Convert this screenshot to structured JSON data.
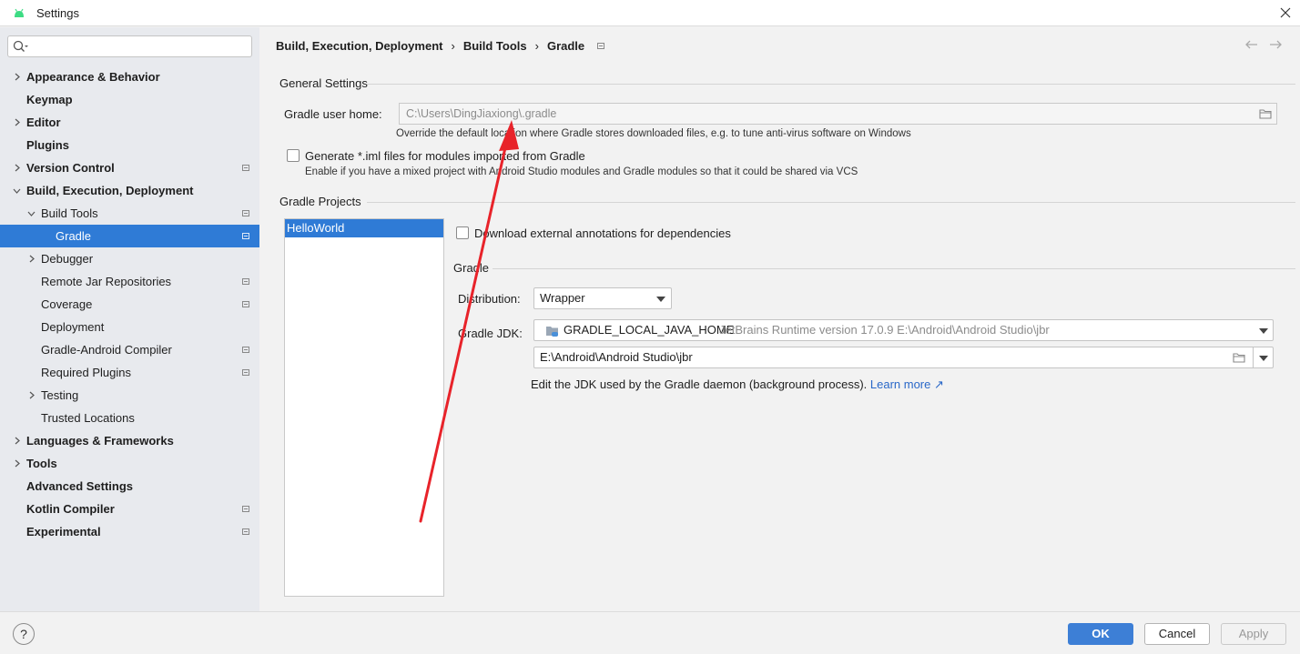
{
  "window": {
    "title": "Settings"
  },
  "search": {
    "placeholder": "",
    "value": ""
  },
  "sidebar": {
    "items": [
      {
        "label": "Appearance & Behavior"
      },
      {
        "label": "Keymap"
      },
      {
        "label": "Editor"
      },
      {
        "label": "Plugins"
      },
      {
        "label": "Version Control"
      },
      {
        "label": "Build, Execution, Deployment"
      },
      {
        "label": "Build Tools"
      },
      {
        "label": "Gradle"
      },
      {
        "label": "Debugger"
      },
      {
        "label": "Remote Jar Repositories"
      },
      {
        "label": "Coverage"
      },
      {
        "label": "Deployment"
      },
      {
        "label": "Gradle-Android Compiler"
      },
      {
        "label": "Required Plugins"
      },
      {
        "label": "Testing"
      },
      {
        "label": "Trusted Locations"
      },
      {
        "label": "Languages & Frameworks"
      },
      {
        "label": "Tools"
      },
      {
        "label": "Advanced Settings"
      },
      {
        "label": "Kotlin Compiler"
      },
      {
        "label": "Experimental"
      }
    ]
  },
  "breadcrumb": {
    "part1": "Build, Execution, Deployment",
    "sep": "›",
    "part2": "Build Tools",
    "part3": "Gradle"
  },
  "general": {
    "title": "General Settings",
    "user_home_label": "Gradle user home:",
    "user_home_value": "C:\\Users\\DingJiaxiong\\.gradle",
    "user_home_hint": "Override the default location where Gradle stores downloaded files, e.g. to tune anti-virus software on Windows",
    "iml_label": "Generate *.iml files for modules imported from Gradle",
    "iml_hint": "Enable if you have a mixed project with Android Studio modules and Gradle modules so that it could be shared via VCS"
  },
  "projects": {
    "title": "Gradle Projects",
    "items": [
      "HelloWorld"
    ],
    "download_annotations_label": "Download external annotations for dependencies"
  },
  "gradle": {
    "title": "Gradle",
    "distribution_label": "Distribution:",
    "distribution_value": "Wrapper",
    "jdk_label": "Gradle JDK:",
    "jdk_name": "GRADLE_LOCAL_JAVA_HOME",
    "jdk_detail": "JetBrains Runtime version 17.0.9 E:\\Android\\Android Studio\\jbr",
    "jdk_path": "E:\\Android\\Android Studio\\jbr",
    "jdk_hint": "Edit the JDK used by the Gradle daemon (background process).",
    "learn_more": "Learn more ↗"
  },
  "footer": {
    "help": "?",
    "ok": "OK",
    "cancel": "Cancel",
    "apply": "Apply"
  },
  "colors": {
    "accent": "#2f7bd6",
    "annotation_arrow": "#e8232a"
  }
}
